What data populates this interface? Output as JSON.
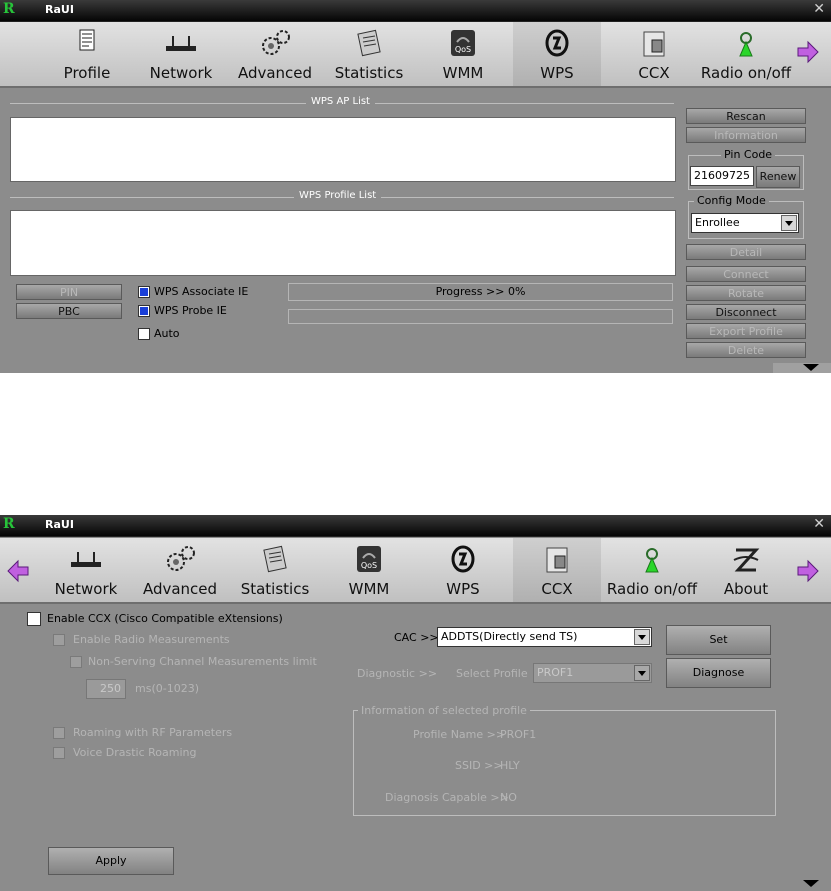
{
  "window1": {
    "title": "RaUI",
    "logo": "R",
    "toolbar": [
      {
        "label": "Profile",
        "icon": "profile-icon"
      },
      {
        "label": "Network",
        "icon": "network-icon"
      },
      {
        "label": "Advanced",
        "icon": "advanced-icon"
      },
      {
        "label": "Statistics",
        "icon": "statistics-icon"
      },
      {
        "label": "WMM",
        "icon": "wmm-icon"
      },
      {
        "label": "WPS",
        "icon": "wps-icon",
        "selected": true
      },
      {
        "label": "CCX",
        "icon": "ccx-icon"
      },
      {
        "label": "Radio on/off",
        "icon": "radio-icon"
      }
    ],
    "wps_ap_list_title": "WPS AP List",
    "wps_profile_list_title": "WPS Profile List",
    "buttons": {
      "rescan": "Rescan",
      "information": "Information",
      "renew": "Renew",
      "detail": "Detail",
      "connect": "Connect",
      "rotate": "Rotate",
      "disconnect": "Disconnect",
      "export_profile": "Export Profile",
      "delete": "Delete",
      "pin": "PIN",
      "pbc": "PBC"
    },
    "pin_code_label": "Pin Code",
    "pin_code_value": "21609725",
    "config_mode_label": "Config Mode",
    "config_mode_value": "Enrollee",
    "checks": {
      "associate": "WPS Associate IE",
      "probe": "WPS Probe IE",
      "auto": "Auto"
    },
    "progress_text": "Progress >> 0%"
  },
  "window2": {
    "title": "RaUI",
    "logo": "R",
    "toolbar": [
      {
        "label": "Network",
        "icon": "network-icon"
      },
      {
        "label": "Advanced",
        "icon": "advanced-icon"
      },
      {
        "label": "Statistics",
        "icon": "statistics-icon"
      },
      {
        "label": "WMM",
        "icon": "wmm-icon"
      },
      {
        "label": "WPS",
        "icon": "wps-icon"
      },
      {
        "label": "CCX",
        "icon": "ccx-icon",
        "selected": true
      },
      {
        "label": "Radio on/off",
        "icon": "radio-icon"
      },
      {
        "label": "About",
        "icon": "about-icon"
      }
    ],
    "enable_ccx": "Enable CCX (Cisco Compatible eXtensions)",
    "enable_radio": "Enable Radio Measurements",
    "non_serving": "Non-Serving Channel Measurements limit",
    "limit_value": "250",
    "limit_unit": "ms(0-1023)",
    "roaming_rf": "Roaming with RF Parameters",
    "voice_drastic": "Voice Drastic Roaming",
    "cac_label": "CAC >>",
    "cac_value": "ADDTS(Directly send TS)",
    "set_button": "Set",
    "diagnostic_label": "Diagnostic >>",
    "select_profile_label": "Select Profile",
    "select_profile_value": "PROF1",
    "diagnose_button": "Diagnose",
    "info_group_title": "Information of selected profile",
    "profile_name_label": "Profile Name >>",
    "profile_name_value": "PROF1",
    "ssid_label": "SSID >>",
    "ssid_value": "HLY",
    "diag_capable_label": "Diagnosis Capable >>",
    "diag_capable_value": "NO",
    "apply_button": "Apply"
  }
}
